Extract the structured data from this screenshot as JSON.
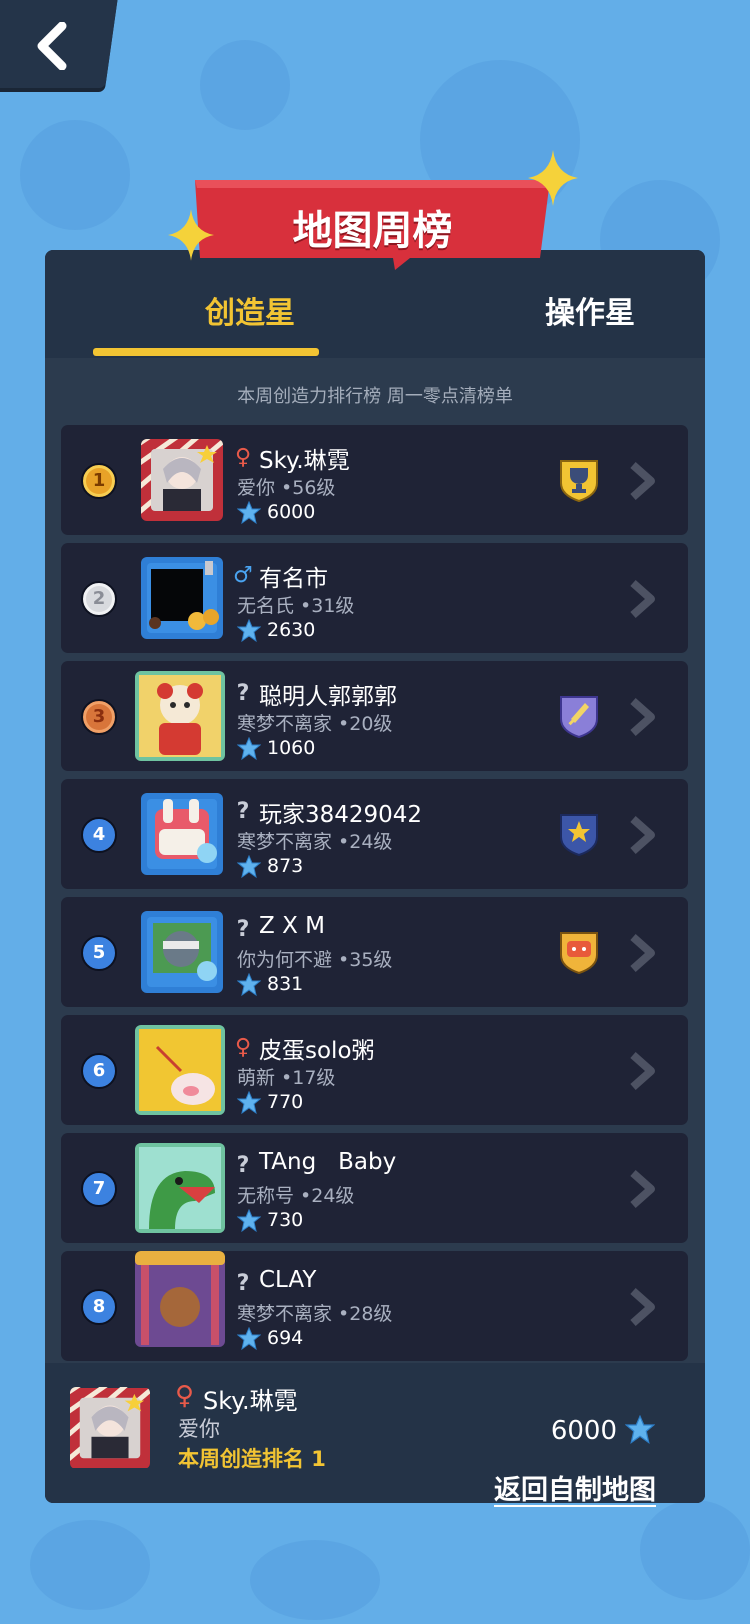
{
  "header": {
    "back_icon": "chevron-left-icon",
    "title": "地图周榜"
  },
  "tabs": [
    {
      "label": "创造星",
      "active": true
    },
    {
      "label": "操作星",
      "active": false
    }
  ],
  "subtitle": "本周创造力排行榜 周一零点清榜单",
  "colors": {
    "accent": "#f2c433",
    "panel": "#2c3b4e",
    "row": "#1f2336",
    "background": "#63aee8",
    "ribbon": "#d8303c"
  },
  "entries": [
    {
      "rank": "1",
      "rank_style": "gold",
      "gender": "♀",
      "gender_type": "female",
      "name": "Sky.琳霓",
      "sub": "爱你 •56级",
      "score": "6000",
      "badge": "trophy-badge-icon"
    },
    {
      "rank": "2",
      "rank_style": "silver",
      "gender": "♂",
      "gender_type": "male",
      "name": "有名市",
      "sub": "无名氏 •31级",
      "score": "2630",
      "badge": ""
    },
    {
      "rank": "3",
      "rank_style": "bronze",
      "gender": "?",
      "gender_type": "unknown",
      "name": "聪明人郭郭郭",
      "sub": "寒梦不离家 •20级",
      "score": "1060",
      "badge": "sword-badge-icon"
    },
    {
      "rank": "4",
      "rank_style": "blue",
      "gender": "?",
      "gender_type": "unknown",
      "name": "玩家38429042",
      "sub": "寒梦不离家 •24级",
      "score": "873",
      "badge": "star-badge-icon"
    },
    {
      "rank": "5",
      "rank_style": "blue",
      "gender": "?",
      "gender_type": "unknown",
      "name": "Z X M",
      "sub": "你为何不避 •35级",
      "score": "831",
      "badge": "face-badge-icon"
    },
    {
      "rank": "6",
      "rank_style": "blue",
      "gender": "♀",
      "gender_type": "female",
      "name": "皮蛋solo粥",
      "sub": "萌新 •17级",
      "score": "770",
      "badge": ""
    },
    {
      "rank": "7",
      "rank_style": "blue",
      "gender": "?",
      "gender_type": "unknown",
      "name": "TAng   Baby",
      "sub": "无称号 •24级",
      "score": "730",
      "badge": ""
    },
    {
      "rank": "8",
      "rank_style": "blue",
      "gender": "?",
      "gender_type": "unknown",
      "name": "CLAY",
      "sub": "寒梦不离家 •28级",
      "score": "694",
      "badge": ""
    }
  ],
  "footer": {
    "gender": "♀",
    "name": "Sky.琳霓",
    "sub": "爱你",
    "rank_text": "本周创造排名 1",
    "score": "6000"
  },
  "return_link": "返回自制地图"
}
